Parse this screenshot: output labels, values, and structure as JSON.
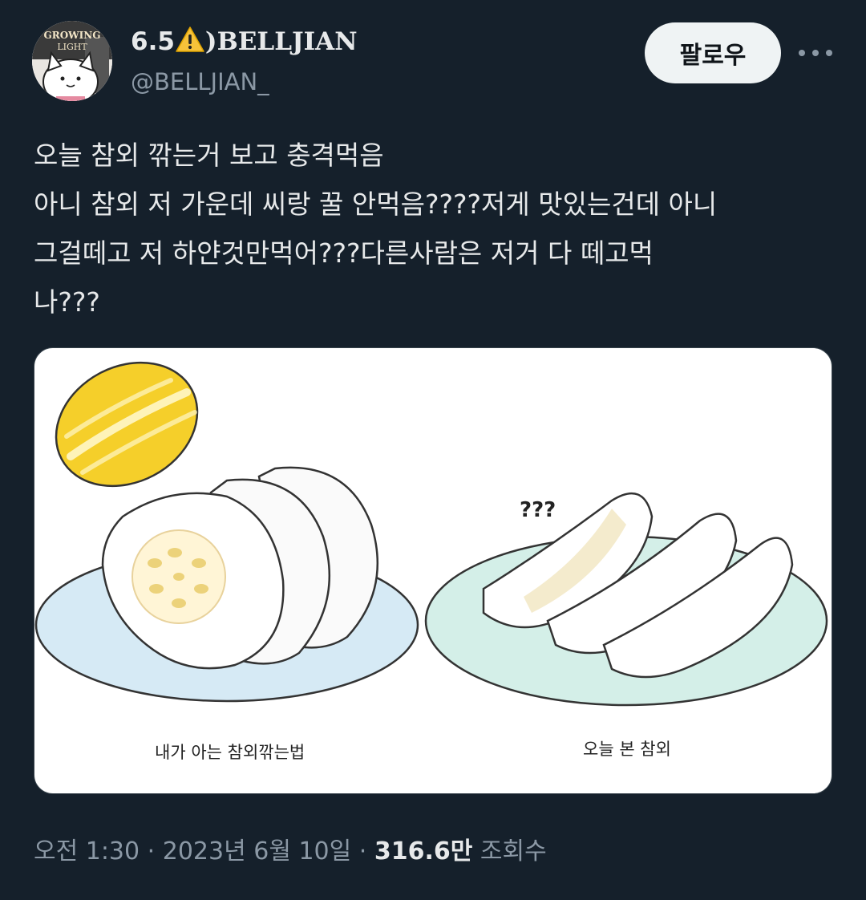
{
  "user": {
    "display_name_prefix": "6.5",
    "display_name_suffix": ")BELLJIAN",
    "handle": "@BELLJIAN_",
    "avatar_text_line1": "GROWING",
    "avatar_text_line2": "LIGHT"
  },
  "actions": {
    "follow_label": "팔로우",
    "more_icon": "more-horizontal-icon"
  },
  "tweet": {
    "lines": [
      "오늘 참외 깎는거 보고 충격먹음",
      "아니 참외 저 가운데 씨랑 꿀 안먹음????저게 맛있는건데 아니",
      "그걸떼고 저 하얀것만먹어???다른사람은 저거 다 떼고먹",
      "나???"
    ]
  },
  "image": {
    "left_caption": "내가 아는 참외깎는법",
    "right_caption": "오늘 본 참외",
    "question_marks": "???"
  },
  "meta": {
    "time": "오전 1:30",
    "separator": "·",
    "date": "2023년 6월 10일",
    "views_count": "316.6만",
    "views_label": "조회수"
  },
  "colors": {
    "background": "#15202b",
    "text": "#e7e9ea",
    "secondary_text": "#8b98a5",
    "follow_button_bg": "#eff3f4",
    "melon_yellow": "#f5cf2a",
    "plate_blue": "#d6eaf5",
    "plate_green": "#d4efe8"
  }
}
